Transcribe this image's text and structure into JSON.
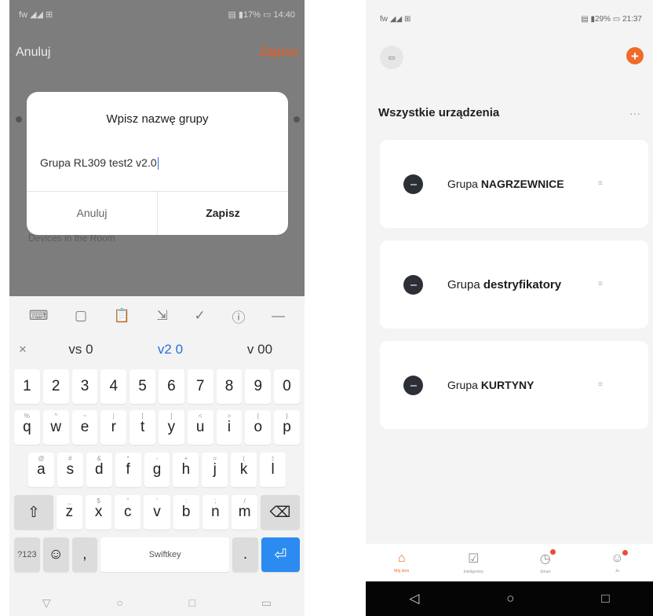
{
  "left": {
    "status": {
      "left": "fw ◢◢ ⊞",
      "right": "▤ ▮17% ▭ 14:40"
    },
    "topbar": {
      "cancel": "Anuluj",
      "save": "Zapisz"
    },
    "behind_hint": "Devices in the Room",
    "dialog": {
      "title": "Wpisz nazwę grupy",
      "input_value": "Grupa RL309 test2 v2.0",
      "cancel_label": "Anuluj",
      "save_label": "Zapisz"
    },
    "keyboard": {
      "toolbar_icons": [
        "keyboard-icon",
        "sticker-icon",
        "clipboard-icon",
        "cursor-move-icon",
        "handwriting-icon",
        "info-icon",
        "more-icon"
      ],
      "toolbar_glyphs": [
        "⌨",
        "▢",
        "📋",
        "⇲",
        "✓",
        "ⓘ",
        "—"
      ],
      "suggestions": [
        "vs 0",
        "v2 0",
        "v 00"
      ],
      "close_glyph": "✕",
      "row_numbers": [
        "1",
        "2",
        "3",
        "4",
        "5",
        "6",
        "7",
        "8",
        "9",
        "0"
      ],
      "row_q": [
        "q",
        "w",
        "e",
        "r",
        "t",
        "y",
        "u",
        "i",
        "o",
        "p"
      ],
      "row_q_alt": [
        "%",
        "^",
        "~",
        "|",
        "[",
        "]",
        "<",
        ">",
        "{",
        "}"
      ],
      "row_a": [
        "a",
        "s",
        "d",
        "f",
        "g",
        "h",
        "j",
        "k",
        "l"
      ],
      "row_a_alt": [
        "@",
        "#",
        "&",
        "*",
        "-",
        "+",
        "=",
        "(",
        ")"
      ],
      "row_z": [
        "z",
        "x",
        "c",
        "v",
        "b",
        "n",
        "m"
      ],
      "row_z_alt": [
        "_",
        "$",
        "\"",
        "'",
        ":",
        ";",
        "/"
      ],
      "shift_glyph": "⇧",
      "backspace_glyph": "⌫",
      "sym_label": "?123",
      "emoji_glyph": "☺",
      "comma_label": ",",
      "space_label": "Swiftkey",
      "period_label": ".",
      "enter_glyph": "⏎"
    },
    "navbar": [
      "▽",
      "○",
      "□",
      "▭"
    ]
  },
  "right": {
    "status": {
      "left": "fw ◢◢ ⊞",
      "right": "▤ ▮29% ▭ 21:37"
    },
    "top_icon_label": "▭",
    "add_glyph": "+",
    "section_title": "Wszystkie urządzenia",
    "more_glyph": "···",
    "devices": [
      {
        "prefix": "Grupa ",
        "name": "NAGRZEWNICE"
      },
      {
        "prefix": "Grupa ",
        "name": "destryfikatory"
      },
      {
        "prefix": "Grupa ",
        "name": "KURTYNY"
      }
    ],
    "handle_glyph": "≡",
    "tabs": [
      {
        "label": "Mój dom",
        "glyph": "⌂"
      },
      {
        "label": "Inteligentny",
        "glyph": "☑"
      },
      {
        "label": "Smart",
        "glyph": "◷"
      },
      {
        "label": "Ja",
        "glyph": "☺"
      }
    ],
    "navbar": [
      "◁",
      "○",
      "□"
    ]
  }
}
